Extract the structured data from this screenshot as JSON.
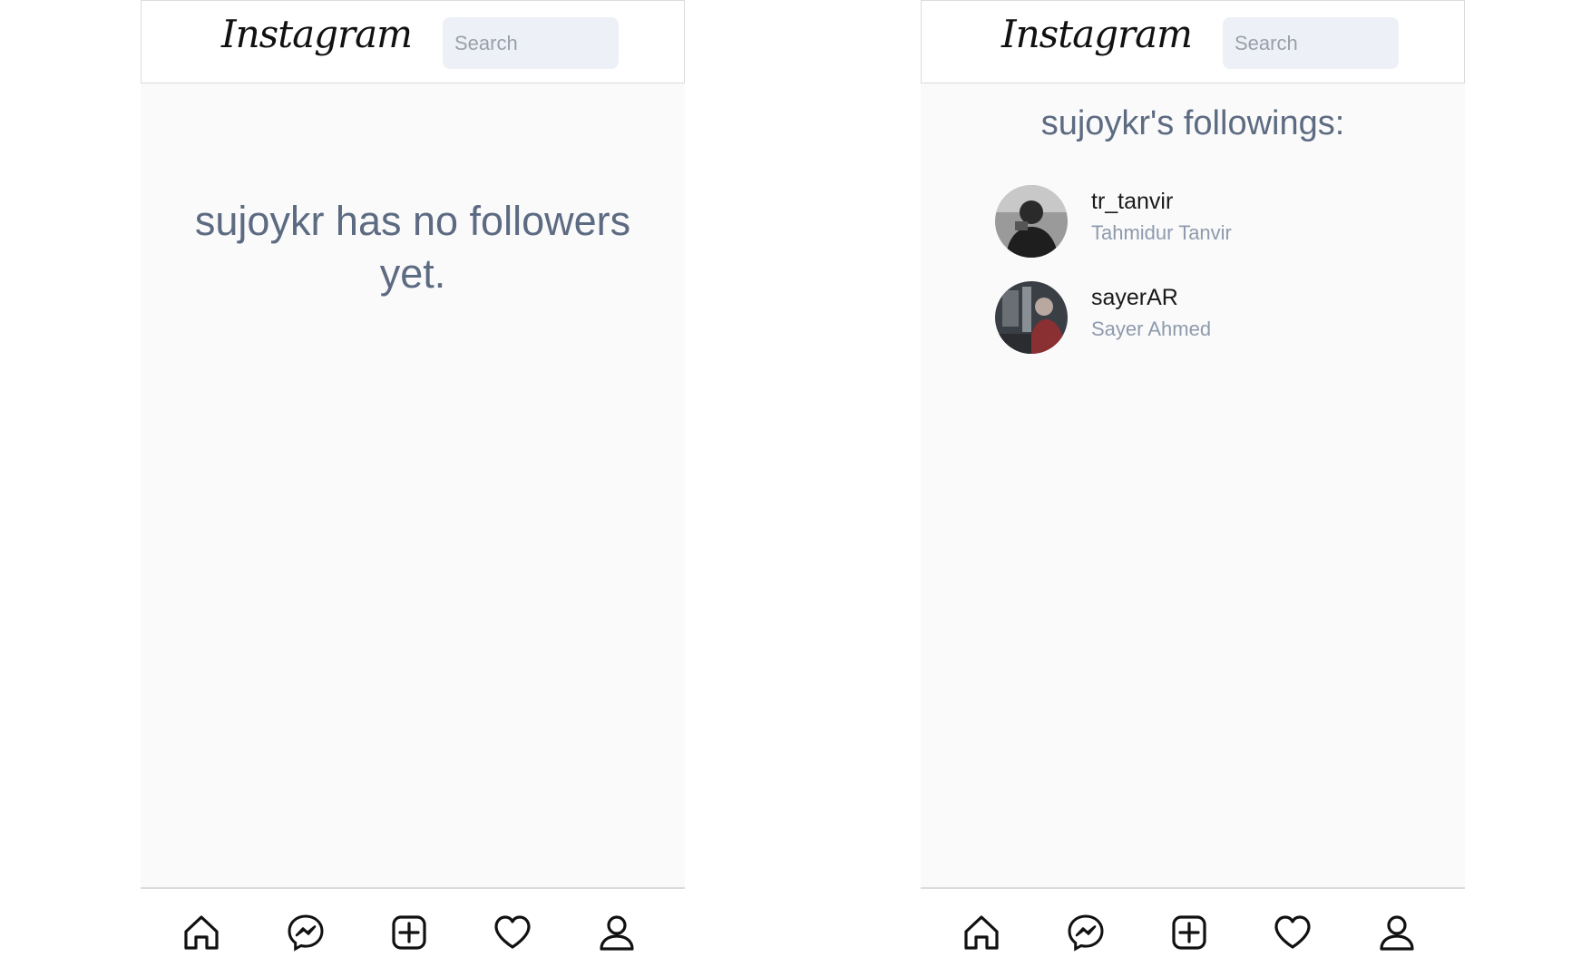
{
  "left_screen": {
    "header": {
      "logo_text": "Instagram",
      "search_placeholder": "Search"
    },
    "empty_message": "sujoykr has no followers yet."
  },
  "right_screen": {
    "header": {
      "logo_text": "Instagram",
      "search_placeholder": "Search"
    },
    "list_title": "sujoykr's followings:",
    "users": [
      {
        "username": "tr_tanvir",
        "full_name": "Tahmidur Tanvir"
      },
      {
        "username": "sayerAR",
        "full_name": "Sayer Ahmed"
      }
    ]
  },
  "bottom_nav": {
    "icons": [
      "home-icon",
      "messenger-icon",
      "add-post-icon",
      "heart-icon",
      "profile-icon"
    ]
  },
  "colors": {
    "background": "#fafafa",
    "border": "#dbdbdb",
    "muted_text": "#5d6b82",
    "secondary_text": "#8e9aad",
    "search_bg": "#edf0f6"
  }
}
